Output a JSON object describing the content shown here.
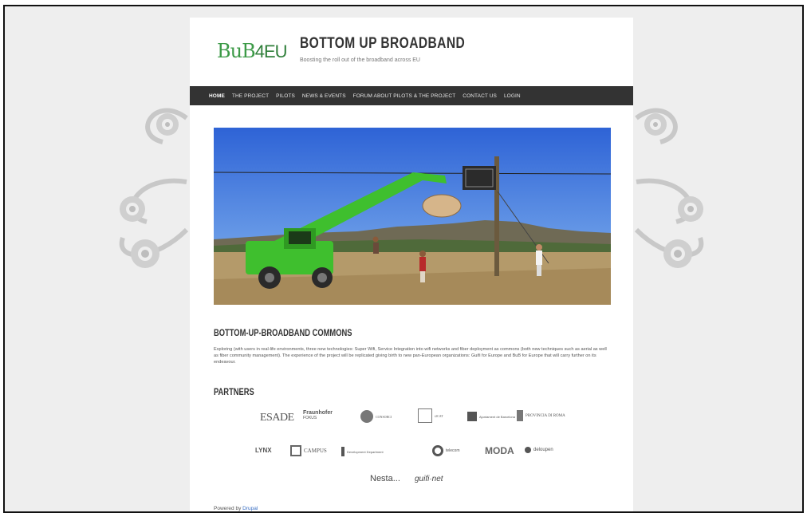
{
  "site": {
    "logo_main": "BuB",
    "logo_suffix": "4EU",
    "title": "BOTTOM UP BROADBAND",
    "slogan": "Boosting the roll out of the broadband across EU"
  },
  "nav": {
    "items": [
      {
        "label": "Home",
        "active": true
      },
      {
        "label": "The Project"
      },
      {
        "label": "Pilots"
      },
      {
        "label": "News & Events"
      },
      {
        "label": "Forum about pilots & the project"
      },
      {
        "label": "Contact us"
      },
      {
        "label": "Login"
      }
    ]
  },
  "main": {
    "heading": "BOTTOM-UP-BROADBAND COMMONS",
    "body": "Exploring (with users in real-life environments, three new technologies: Super Wifi, Service Integration into wifi networks and fiber deployment as commons (both new techniques such as aerial as well as fiber community management). The experience of the project will be replicated giving birth to new pan-European organizations: Guifi for Europe and BuB for Europe that will carry further on its endeavour.",
    "partners_heading": "PARTNERS"
  },
  "partners": {
    "esade": "ESADE",
    "fraunhofer": "Fraunhofer",
    "fraunhofer_sub": "FOKUS",
    "circle": "CONSORCI",
    "box": "i2CAT",
    "ajuntament": "Ajuntament de Barcelona",
    "provincia": "PROVINCIA DI ROMA",
    "lynx": "LYNX",
    "campus": "CAMPUS",
    "department": "Development Department",
    "wide": "telecom",
    "moda": "MODA",
    "deloitte": "deloupen",
    "nesta": "Nesta...",
    "guifi": "guifi·net"
  },
  "footer": {
    "powered_by": "Powered by",
    "drupal": "Drupal"
  },
  "colors": {
    "navbar": "#333333",
    "logo_green": "#3c9a47",
    "page_bg": "#eeeeee",
    "link": "#3a6fc4"
  }
}
